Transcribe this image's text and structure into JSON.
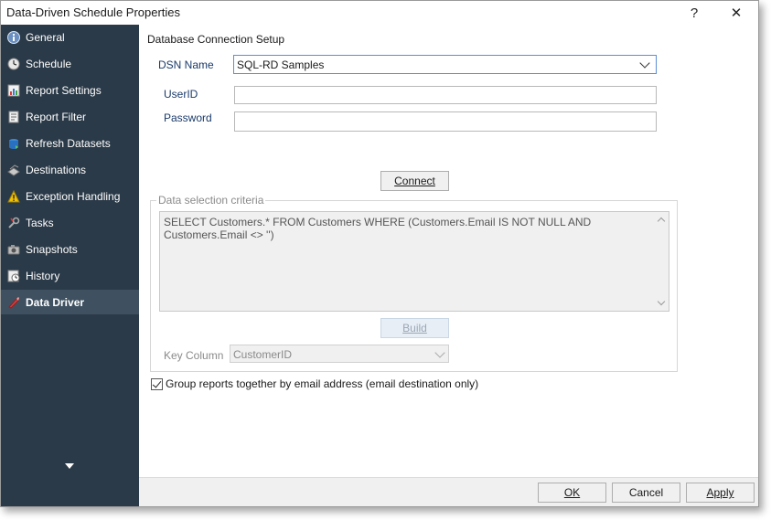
{
  "window": {
    "title": "Data-Driven Schedule Properties",
    "help_label": "?",
    "close_label": "✕"
  },
  "sidebar": {
    "items": [
      {
        "label": "General",
        "icon": "info-icon",
        "active": false
      },
      {
        "label": "Schedule",
        "icon": "clock-icon",
        "active": false
      },
      {
        "label": "Report Settings",
        "icon": "report-settings-icon",
        "active": false
      },
      {
        "label": "Report Filter",
        "icon": "report-filter-icon",
        "active": false
      },
      {
        "label": "Refresh Datasets",
        "icon": "refresh-datasets-icon",
        "active": false
      },
      {
        "label": "Destinations",
        "icon": "destinations-icon",
        "active": false
      },
      {
        "label": "Exception Handling",
        "icon": "warning-icon",
        "active": false
      },
      {
        "label": "Tasks",
        "icon": "tasks-icon",
        "active": false
      },
      {
        "label": "Snapshots",
        "icon": "camera-icon",
        "active": false
      },
      {
        "label": "History",
        "icon": "history-icon",
        "active": false
      },
      {
        "label": "Data Driver",
        "icon": "data-driver-icon",
        "active": true
      }
    ]
  },
  "main": {
    "section_title": "Database Connection Setup",
    "dsn_label": "DSN Name",
    "dsn_value": "SQL-RD Samples",
    "userid_label": "UserID",
    "userid_value": "",
    "password_label": "Password",
    "password_value": "",
    "connect_label": "Connect",
    "criteria_legend": "Data selection criteria",
    "criteria_sql": "SELECT Customers.* FROM Customers WHERE (Customers.Email IS NOT NULL AND Customers.Email <> '')",
    "build_label": "Build",
    "key_column_label": "Key Column",
    "key_column_value": "CustomerID",
    "group_checkbox_label": "Group reports together by email address (email destination only)",
    "group_checked": true
  },
  "footer": {
    "ok_label": "OK",
    "cancel_label": "Cancel",
    "apply_label": "Apply"
  },
  "colors": {
    "sidebar_bg": "#2b3a48",
    "sidebar_active": "#3f5161",
    "accent": "#5a8fd6"
  }
}
